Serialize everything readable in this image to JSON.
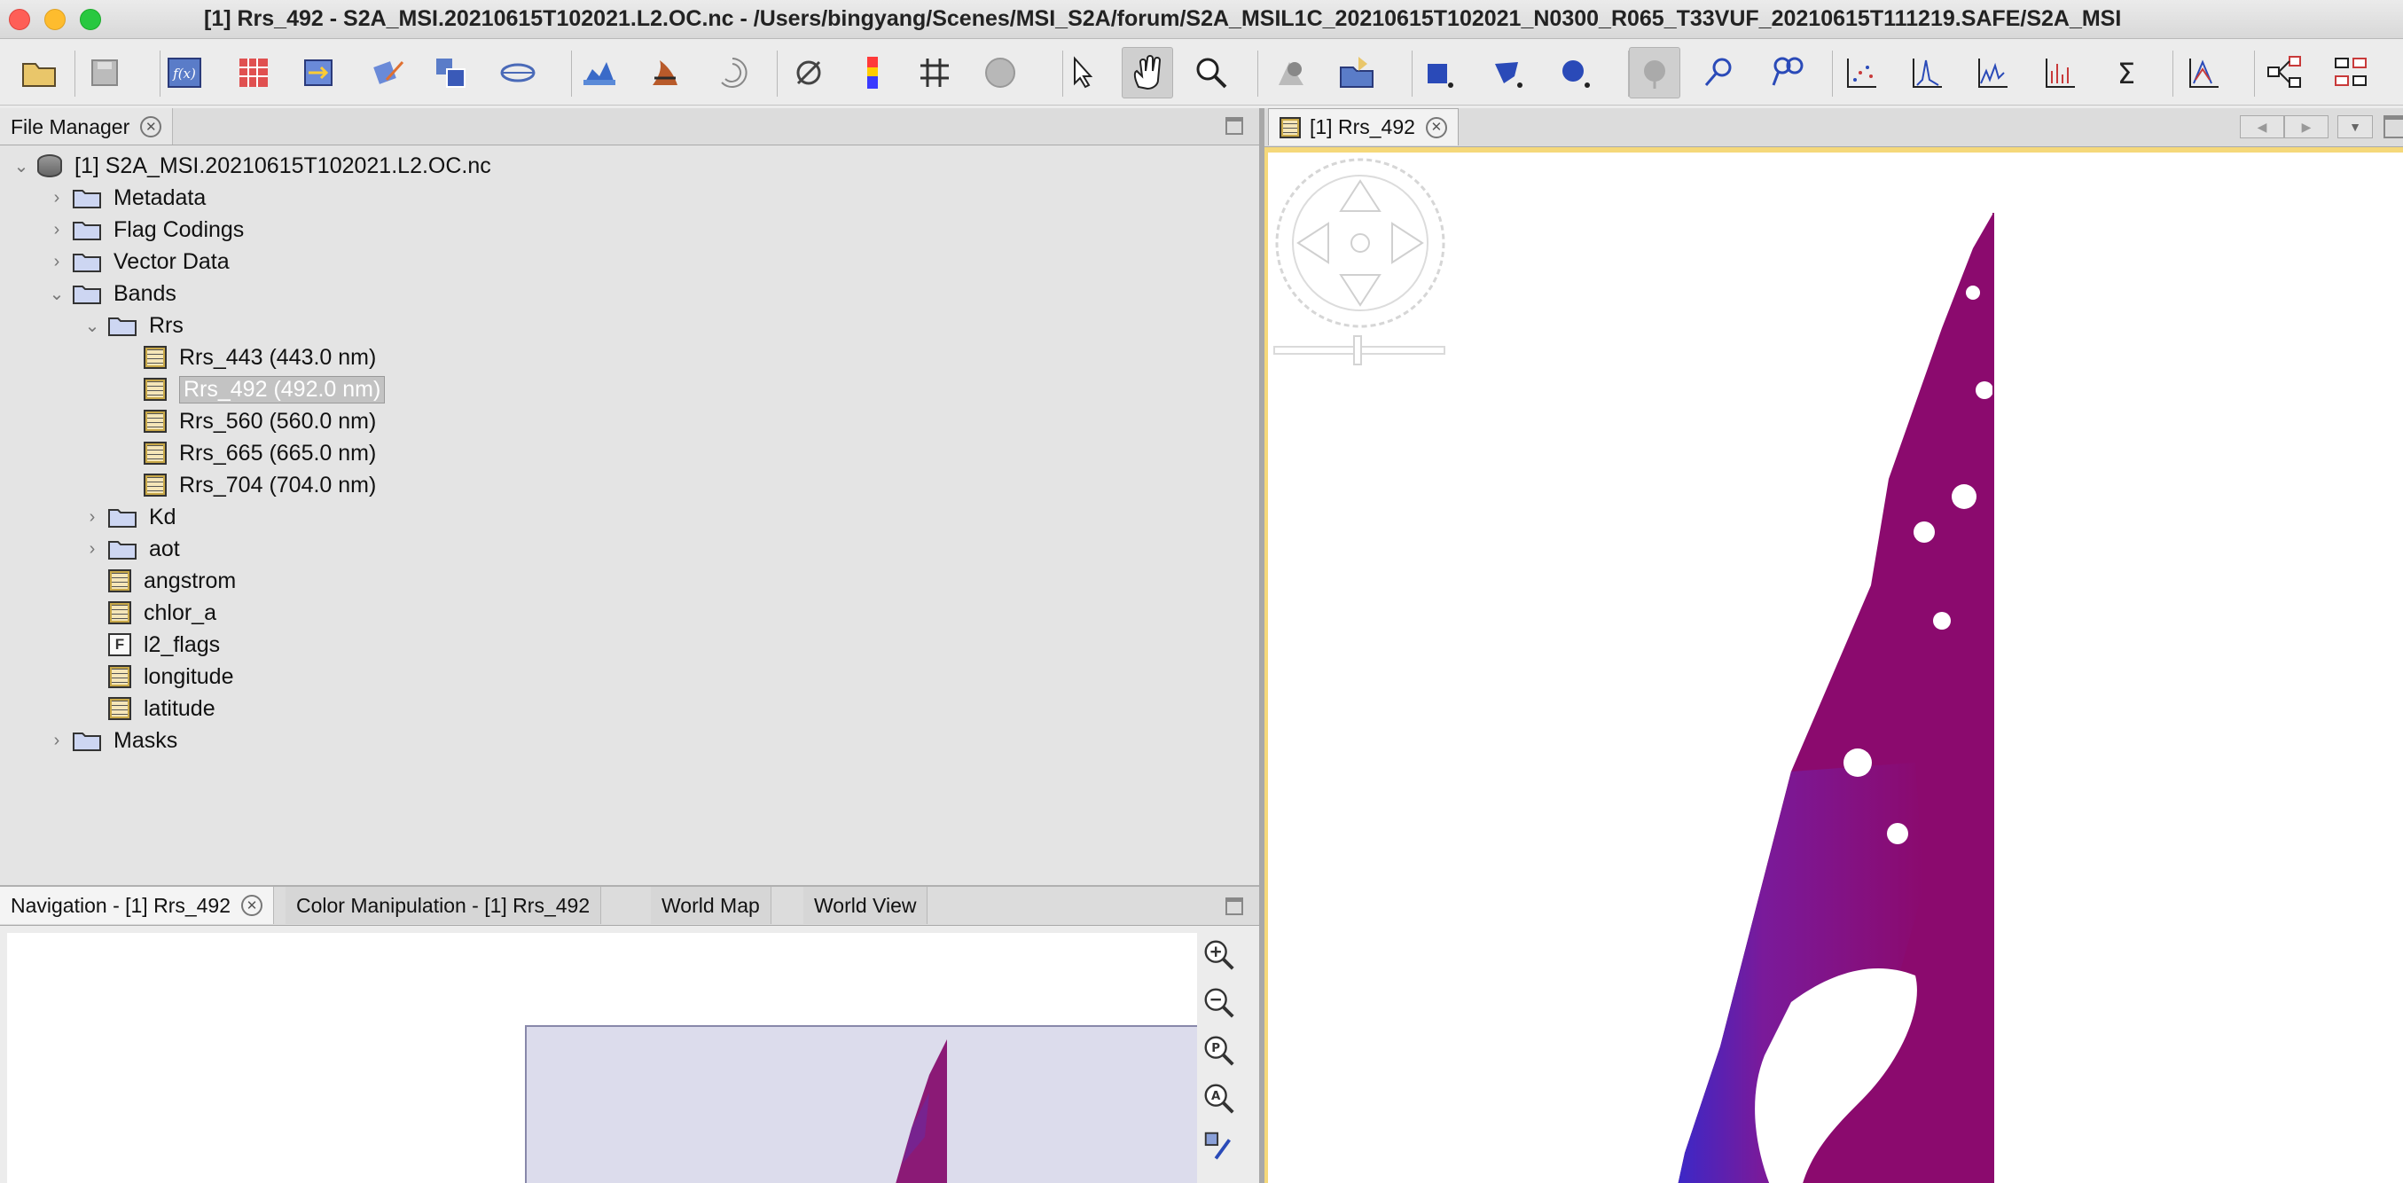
{
  "window": {
    "title": "[1] Rrs_492 - S2A_MSI.20210615T102021.L2.OC.nc - /Users/bingyang/Scenes/MSI_S2A/forum/S2A_MSIL1C_20210615T102021_N0300_R065_T33VUF_20210615T111219.SAFE/S2A_MSI"
  },
  "toolbar": {
    "icons": [
      "open-product-icon",
      "save-product-icon",
      "band-maths-icon",
      "mosaic-icon",
      "reprojection-icon",
      "collocation-icon",
      "subset-icon",
      "graph-builder-icon",
      "land-mask-icon",
      "flip-icon",
      "spectrum-icon",
      "no-data-icon",
      "color-palette-icon",
      "graticule-icon",
      "world-globe-icon",
      "select-tool-icon",
      "pan-tool-icon",
      "zoom-tool-icon",
      "pixel-info-icon",
      "export-icon",
      "rectangle-drawing-icon",
      "polygon-drawing-icon",
      "ellipse-drawing-icon",
      "pin-manager-icon",
      "pin-placing-icon",
      "gcp-placing-icon",
      "scatter-plot-icon",
      "histogram-icon",
      "profile-plot-icon",
      "correlative-plot-icon",
      "statistics-icon",
      "information-icon",
      "graph-processing-icon",
      "batch-processing-icon"
    ]
  },
  "file_manager": {
    "tab_label": "File Manager",
    "tree": [
      {
        "label": "[1] S2A_MSI.20210615T102021.L2.OC.nc",
        "type": "product",
        "arrow": "v"
      },
      {
        "label": "Metadata",
        "type": "folder",
        "arrow": ">"
      },
      {
        "label": "Flag Codings",
        "type": "folder",
        "arrow": ">"
      },
      {
        "label": "Vector Data",
        "type": "folder",
        "arrow": ">"
      },
      {
        "label": "Bands",
        "type": "folder",
        "arrow": "v"
      },
      {
        "label": "Rrs",
        "type": "folder-open",
        "arrow": "v"
      },
      {
        "label": "Rrs_443 (443.0 nm)",
        "type": "band"
      },
      {
        "label": "Rrs_492 (492.0 nm)",
        "type": "band",
        "selected": true
      },
      {
        "label": "Rrs_560 (560.0 nm)",
        "type": "band"
      },
      {
        "label": "Rrs_665 (665.0 nm)",
        "type": "band"
      },
      {
        "label": "Rrs_704 (704.0 nm)",
        "type": "band"
      },
      {
        "label": "Kd",
        "type": "folder",
        "arrow": ">"
      },
      {
        "label": "aot",
        "type": "folder",
        "arrow": ">"
      },
      {
        "label": "angstrom",
        "type": "band"
      },
      {
        "label": "chlor_a",
        "type": "band"
      },
      {
        "label": "l2_flags",
        "type": "flag"
      },
      {
        "label": "longitude",
        "type": "band"
      },
      {
        "label": "latitude",
        "type": "band"
      },
      {
        "label": "Masks",
        "type": "folder",
        "arrow": ">"
      }
    ]
  },
  "bottom_tabs": [
    {
      "label": "Navigation - [1] Rrs_492",
      "closable": true,
      "active": true
    },
    {
      "label": "Color Manipulation - [1] Rrs_492",
      "closable": false
    },
    {
      "label": "World Map",
      "closable": false
    },
    {
      "label": "World View",
      "closable": false
    }
  ],
  "image_view": {
    "tab_label": "[1] Rrs_492"
  },
  "navigation_tools": [
    "zoom-in-icon",
    "zoom-out-icon",
    "zoom-pixel-icon",
    "zoom-all-icon",
    "sync-views-icon"
  ],
  "colors": {
    "water": "#8b0a6e",
    "water_blue": "#3a28c8",
    "highlight": "#c3c3c3",
    "view_border": "#f5d87a"
  }
}
